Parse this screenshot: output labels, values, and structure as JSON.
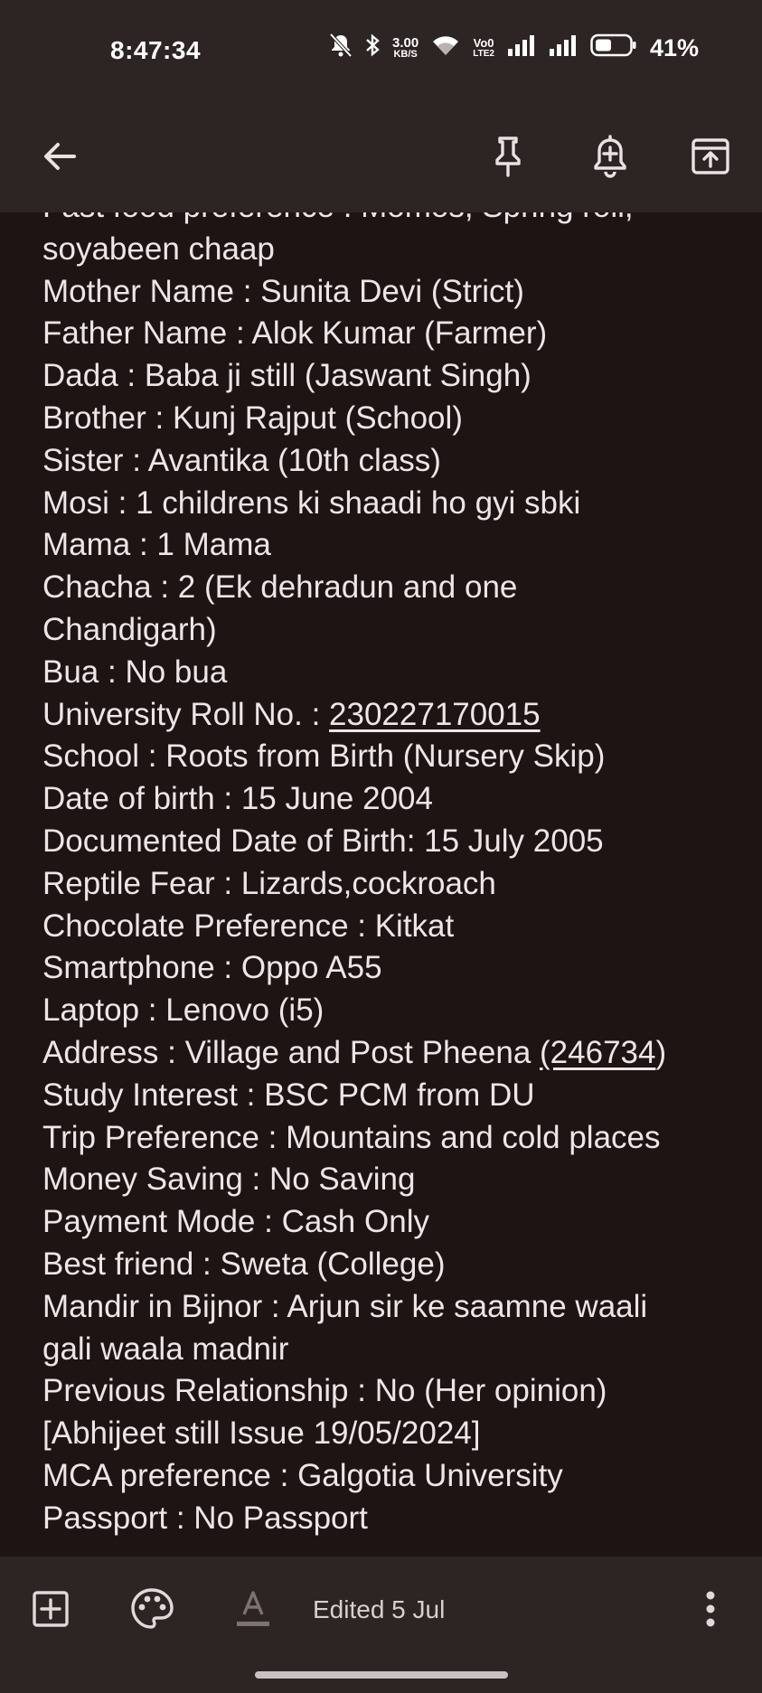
{
  "status_bar": {
    "time": "8:47:34",
    "network_speed_value": "3.00",
    "network_speed_unit": "KB/S",
    "volte_top": "Vo0",
    "volte_bottom": "LTE2",
    "battery_percent": "41%",
    "icons": [
      "bell-muted-icon",
      "bluetooth-icon",
      "wifi-icon",
      "signal-icon",
      "signal-icon",
      "battery-icon"
    ]
  },
  "toolbar": {
    "icons": [
      "back-arrow-icon",
      "pin-icon",
      "reminder-icon",
      "archive-icon"
    ]
  },
  "note": {
    "lines": [
      "Fast food preference : Momos, Spring roll,",
      "soyabeen chaap",
      "Mother Name : Sunita Devi (Strict)",
      "Father Name : Alok Kumar (Farmer)",
      "Dada : Baba ji still (Jaswant Singh)",
      "Brother : Kunj Rajput (School)",
      "Sister : Avantika (10th class)",
      "Mosi : 1 childrens ki shaadi ho gyi sbki",
      "Mama : 1 Mama",
      "Chacha : 2 (Ek dehradun and one",
      "Chandigarh)",
      "Bua : No bua",
      "University Roll No. : ",
      "230227170015",
      "School : Roots from Birth (Nursery Skip)",
      "Date of birth : 15 June 2004",
      "Documented Date of Birth: 15 July 2005",
      "Reptile Fear : Lizards,cockroach",
      "Chocolate Preference : Kitkat",
      "Smartphone : Oppo A55",
      "Laptop : Lenovo (i5)",
      "Address : Village and Post Pheena ",
      "(246734",
      ")",
      "Study Interest : BSC PCM from DU",
      "Trip Preference : Mountains and cold places",
      "Money Saving : No Saving",
      "Payment Mode : Cash Only",
      "Best friend : Sweta (College)",
      "Mandir in Bijnor : Arjun sir ke saamne waali",
      "gali waala madnir",
      "Previous Relationship : No (Her opinion)",
      "[Abhijeet still Issue 19/05/2024]",
      "MCA preference : Galgotia University",
      "Passport : No Passport"
    ]
  },
  "bottom_bar": {
    "edited_label": "Edited 5 Jul",
    "icons": [
      "add-box-icon",
      "palette-icon",
      "text-format-icon",
      "more-vert-icon"
    ]
  },
  "colors": {
    "background": "#1f1414",
    "bars": "#2d2523",
    "text": "#ece6e6"
  }
}
